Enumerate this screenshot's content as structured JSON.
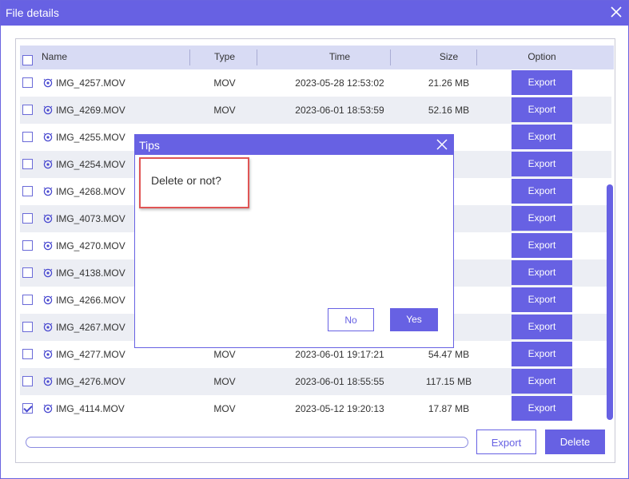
{
  "window": {
    "title": "File details"
  },
  "table": {
    "headers": {
      "name": "Name",
      "type": "Type",
      "time": "Time",
      "size": "Size",
      "option": "Option"
    },
    "export_label": "Export",
    "rows": [
      {
        "name": "IMG_4257.MOV",
        "type": "MOV",
        "time": "2023-05-28 12:53:02",
        "size": "21.26 MB",
        "checked": false
      },
      {
        "name": "IMG_4269.MOV",
        "type": "MOV",
        "time": "2023-06-01 18:53:59",
        "size": "52.16 MB",
        "checked": false
      },
      {
        "name": "IMG_4255.MOV",
        "type": "",
        "time": "",
        "size": "",
        "checked": false
      },
      {
        "name": "IMG_4254.MOV",
        "type": "",
        "time": "",
        "size": "",
        "checked": false
      },
      {
        "name": "IMG_4268.MOV",
        "type": "",
        "time": "",
        "size": "",
        "checked": false
      },
      {
        "name": "IMG_4073.MOV",
        "type": "",
        "time": "",
        "size": "",
        "checked": false
      },
      {
        "name": "IMG_4270.MOV",
        "type": "",
        "time": "",
        "size": "",
        "checked": false
      },
      {
        "name": "IMG_4138.MOV",
        "type": "",
        "time": "",
        "size": "",
        "checked": false
      },
      {
        "name": "IMG_4266.MOV",
        "type": "",
        "time": "",
        "size": "",
        "checked": false
      },
      {
        "name": "IMG_4267.MOV",
        "type": "",
        "time": "",
        "size": "",
        "checked": false
      },
      {
        "name": "IMG_4277.MOV",
        "type": "MOV",
        "time": "2023-06-01 19:17:21",
        "size": "54.47 MB",
        "checked": false
      },
      {
        "name": "IMG_4276.MOV",
        "type": "MOV",
        "time": "2023-06-01 18:55:55",
        "size": "117.15 MB",
        "checked": false
      },
      {
        "name": "IMG_4114.MOV",
        "type": "MOV",
        "time": "2023-05-12 19:20:13",
        "size": "17.87 MB",
        "checked": true
      }
    ]
  },
  "footer": {
    "export_label": "Export",
    "delete_label": "Delete"
  },
  "dialog": {
    "title": "Tips",
    "message": "Delete or not?",
    "no_label": "No",
    "yes_label": "Yes"
  },
  "colors": {
    "accent": "#6761e3",
    "highlight": "#e05555"
  }
}
